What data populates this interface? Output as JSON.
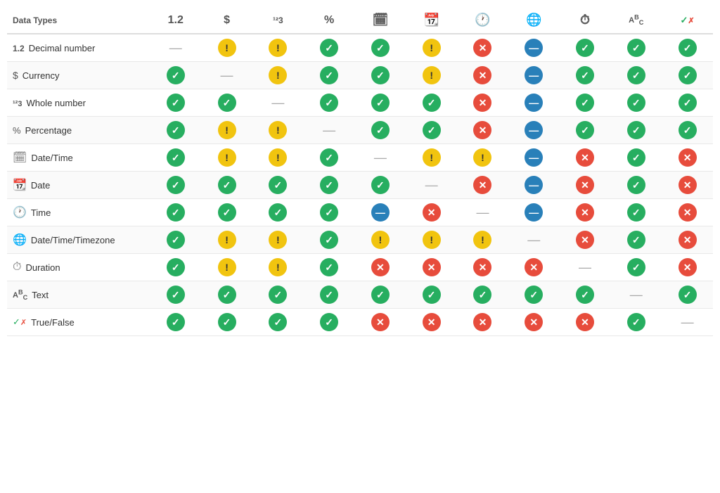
{
  "title": "Data Types",
  "columns": [
    {
      "id": "decimal",
      "icon": "1.2",
      "label": "1.2"
    },
    {
      "id": "currency",
      "icon": "$",
      "label": "$"
    },
    {
      "id": "whole",
      "icon": "¹²₃",
      "label": "¹²3"
    },
    {
      "id": "pct",
      "icon": "%",
      "label": "%"
    },
    {
      "id": "datetime",
      "icon": "📅",
      "label": "datetime"
    },
    {
      "id": "date",
      "icon": "📆",
      "label": "date"
    },
    {
      "id": "time",
      "icon": "🕐",
      "label": "time"
    },
    {
      "id": "dttz",
      "icon": "🌐",
      "label": "dttz"
    },
    {
      "id": "duration",
      "icon": "⏱",
      "label": "duration"
    },
    {
      "id": "text",
      "icon": "ABc",
      "label": "text"
    },
    {
      "id": "truefalse",
      "icon": "✓✗",
      "label": "truefalse"
    }
  ],
  "rows": [
    {
      "label": "Decimal number",
      "icon_text": "1.2",
      "cells": [
        "dash",
        "yellow",
        "yellow",
        "green",
        "green",
        "yellow",
        "red",
        "blue",
        "green",
        "green",
        "green"
      ]
    },
    {
      "label": "Currency",
      "icon_text": "$",
      "cells": [
        "green",
        "dash",
        "yellow",
        "green",
        "green",
        "yellow",
        "red",
        "blue",
        "green",
        "green",
        "green"
      ]
    },
    {
      "label": "Whole number",
      "icon_text": "¹²3",
      "cells": [
        "green",
        "green",
        "dash",
        "green",
        "green",
        "green",
        "red",
        "blue",
        "green",
        "green",
        "green"
      ]
    },
    {
      "label": "Percentage",
      "icon_text": "%",
      "cells": [
        "green",
        "yellow",
        "yellow",
        "dash",
        "green",
        "green",
        "red",
        "blue",
        "green",
        "green",
        "green"
      ]
    },
    {
      "label": "Date/Time",
      "icon_text": "📅",
      "cells": [
        "green",
        "yellow",
        "yellow",
        "green",
        "dash",
        "yellow",
        "yellow",
        "blue",
        "red",
        "green",
        "red"
      ]
    },
    {
      "label": "Date",
      "icon_text": "📆",
      "cells": [
        "green",
        "green",
        "green",
        "green",
        "green",
        "dash",
        "red",
        "blue",
        "red",
        "green",
        "red"
      ]
    },
    {
      "label": "Time",
      "icon_text": "🕐",
      "cells": [
        "green",
        "green",
        "green",
        "green",
        "blue",
        "red",
        "dash",
        "blue",
        "red",
        "green",
        "red"
      ]
    },
    {
      "label": "Date/Time/Timezone",
      "icon_text": "🌐",
      "cells": [
        "green",
        "yellow",
        "yellow",
        "green",
        "yellow",
        "yellow",
        "yellow",
        "dash",
        "red",
        "green",
        "red"
      ]
    },
    {
      "label": "Duration",
      "icon_text": "⏱",
      "cells": [
        "green",
        "yellow",
        "yellow",
        "green",
        "red",
        "red",
        "red",
        "red",
        "dash",
        "green",
        "red"
      ]
    },
    {
      "label": "Text",
      "icon_text": "ABc",
      "cells": [
        "green",
        "green",
        "green",
        "green",
        "green",
        "green",
        "green",
        "green",
        "green",
        "dash",
        "green"
      ]
    },
    {
      "label": "True/False",
      "icon_text": "✓✗",
      "cells": [
        "green",
        "green",
        "green",
        "green",
        "red",
        "red",
        "red",
        "red",
        "red",
        "green",
        "dash"
      ]
    }
  ]
}
